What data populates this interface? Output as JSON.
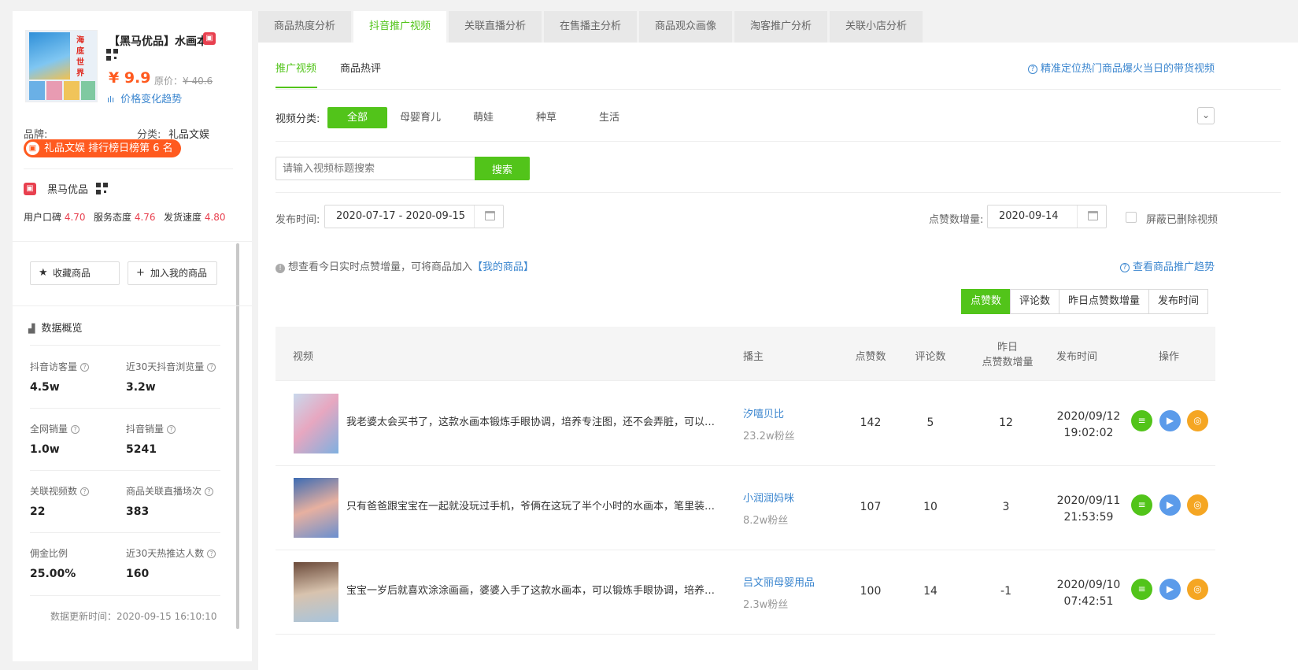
{
  "product": {
    "name": "【黑马优品】水画本",
    "thumb_text": "海底世界",
    "price": "¥ 9.9",
    "orig_label": "原价：",
    "orig_price": "¥ 40.6",
    "trend_link": "价格变化趋势",
    "brand_label": "品牌:",
    "category_label": "分类:",
    "category_value": "礼品文娱",
    "rank_badge": "礼品文娱 排行榜日榜第 6 名"
  },
  "store": {
    "name": "黑马优品",
    "scores": [
      {
        "label": "用户口碑",
        "value": "4.70"
      },
      {
        "label": "服务态度",
        "value": "4.76"
      },
      {
        "label": "发货速度",
        "value": "4.80"
      }
    ]
  },
  "actions": {
    "favorite": "收藏商品",
    "add_mine": "加入我的商品"
  },
  "overview": {
    "title": "数据概览",
    "metrics": [
      {
        "label": "抖音访客量",
        "value": "4.5w"
      },
      {
        "label": "近30天抖音浏览量",
        "value": "3.2w"
      },
      {
        "label": "全网销量",
        "value": "1.0w"
      },
      {
        "label": "抖音销量",
        "value": "5241"
      },
      {
        "label": "关联视频数",
        "value": "22"
      },
      {
        "label": "商品关联直播场次",
        "value": "383"
      },
      {
        "label": "佣金比例",
        "value": "25.00%"
      },
      {
        "label": "近30天热推达人数",
        "value": "160"
      }
    ],
    "update_time": "数据更新时间：2020-09-15 16:10:10"
  },
  "tabs": [
    "商品热度分析",
    "抖音推广视频",
    "关联直播分析",
    "在售播主分析",
    "商品观众画像",
    "淘客推广分析",
    "关联小店分析"
  ],
  "subtabs": [
    "推广视频",
    "商品热评"
  ],
  "help_top": "精准定位热门商品爆火当日的带货视频",
  "category_label": "视频分类:",
  "categories": [
    "全部",
    "母婴育儿",
    "萌娃",
    "种草",
    "生活"
  ],
  "search": {
    "placeholder": "请输入视频标题搜索",
    "button": "搜索"
  },
  "filters": {
    "publish_label": "发布时间:",
    "publish_range": "2020-07-17 - 2020-09-15",
    "likes_label": "点赞数增量:",
    "likes_date": "2020-09-14",
    "hide_deleted": "屏蔽已删除视频"
  },
  "notice": {
    "text": "想查看今日实时点赞增量，可将商品加入",
    "link": "【我的商品】"
  },
  "help_trend": "查看商品推广趋势",
  "sort_options": [
    "点赞数",
    "评论数",
    "昨日点赞数增量",
    "发布时间"
  ],
  "table": {
    "headers": {
      "video": "视频",
      "author": "播主",
      "likes": "点赞数",
      "comments": "评论数",
      "yesterday_1": "昨日",
      "yesterday_2": "点赞数增量",
      "published": "发布时间",
      "ops": "操作"
    },
    "rows": [
      {
        "title": "我老婆太会买书了，这款水画本锻炼手眼协调，培养专注图，还不会弄脏，可以重复使用",
        "author": "汐嘻贝比",
        "fans": "23.2w粉丝",
        "likes": "142",
        "comments": "5",
        "inc": "12",
        "date": "2020/09/12",
        "time": "19:02:02"
      },
      {
        "title": "只有爸爸跟宝宝在一起就没玩过手机，爷俩在这玩了半个小时的水画本，笔里装的是清水",
        "author": "小润润妈咪",
        "fans": "8.2w粉丝",
        "likes": "107",
        "comments": "10",
        "inc": "3",
        "date": "2020/09/11",
        "time": "21:53:59"
      },
      {
        "title": "宝宝一岁后就喜欢涂涂画画，婆婆入手了这款水画本，可以锻炼手眼协调，培养专注力",
        "author": "吕文丽母婴用品",
        "fans": "2.3w粉丝",
        "likes": "100",
        "comments": "14",
        "inc": "-1",
        "date": "2020/09/10",
        "time": "07:42:51"
      }
    ]
  },
  "colors": {
    "accent": "#52c41a",
    "link": "#3b86cf",
    "price": "#ff5a1f",
    "score": "#e8404f",
    "op_green": "#52c41a",
    "op_blue": "#5b9bea",
    "op_orange": "#f5a623"
  }
}
